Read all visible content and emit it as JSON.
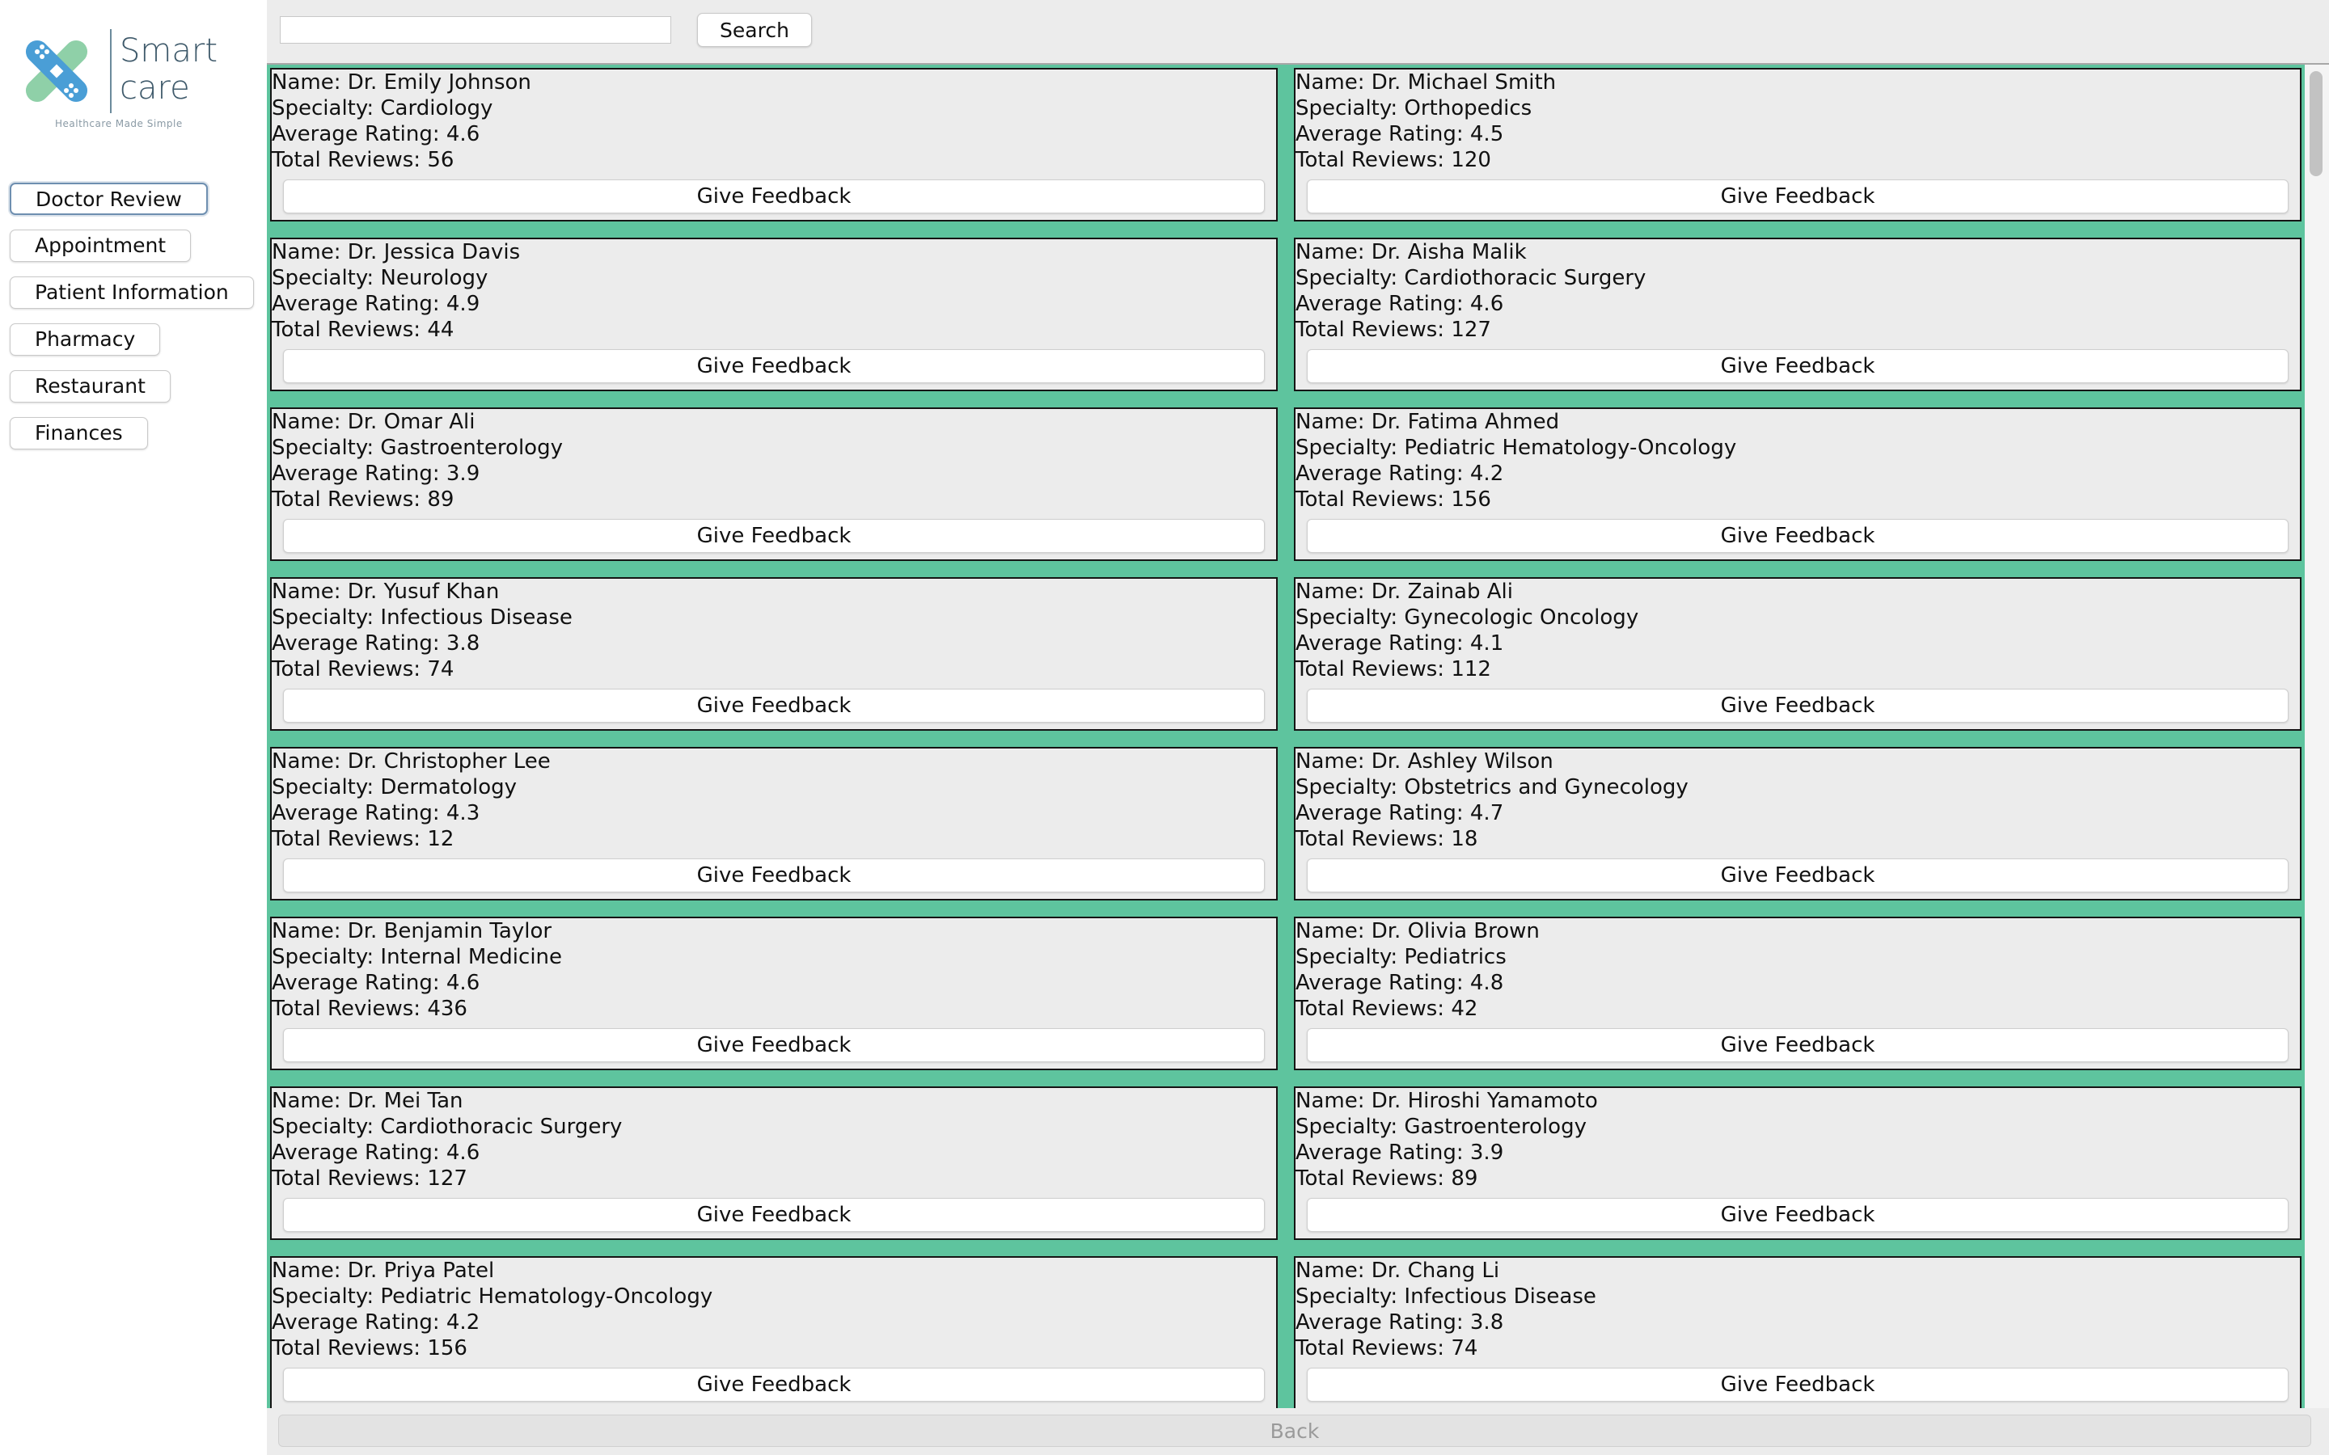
{
  "app": {
    "logo_line1": "Smart",
    "logo_line2": "care",
    "tagline": "Healthcare Made Simple",
    "accent_color": "#5ec49e"
  },
  "sidebar": {
    "items": [
      {
        "label": "Doctor Review",
        "active": true
      },
      {
        "label": "Appointment"
      },
      {
        "label": "Patient Information"
      },
      {
        "label": "Pharmacy"
      },
      {
        "label": "Restaurant"
      },
      {
        "label": "Finances"
      }
    ]
  },
  "search": {
    "value": "",
    "button_label": "Search"
  },
  "labels": {
    "name": "Name: ",
    "specialty": "Specialty: ",
    "rating": "Average Rating: ",
    "reviews": "Total Reviews: ",
    "feedback_button": "Give Feedback"
  },
  "doctors": [
    {
      "name": "Dr. Emily Johnson",
      "specialty": "Cardiology",
      "rating": "4.6",
      "reviews": "56"
    },
    {
      "name": "Dr. Michael Smith",
      "specialty": "Orthopedics",
      "rating": "4.5",
      "reviews": "120"
    },
    {
      "name": "Dr. Jessica Davis",
      "specialty": "Neurology",
      "rating": "4.9",
      "reviews": "44"
    },
    {
      "name": "Dr. Aisha Malik",
      "specialty": "Cardiothoracic Surgery",
      "rating": "4.6",
      "reviews": "127"
    },
    {
      "name": "Dr. Omar Ali",
      "specialty": "Gastroenterology",
      "rating": "3.9",
      "reviews": "89"
    },
    {
      "name": "Dr. Fatima Ahmed",
      "specialty": "Pediatric Hematology-Oncology",
      "rating": "4.2",
      "reviews": "156"
    },
    {
      "name": "Dr. Yusuf Khan",
      "specialty": "Infectious Disease",
      "rating": "3.8",
      "reviews": "74"
    },
    {
      "name": "Dr. Zainab Ali",
      "specialty": "Gynecologic Oncology",
      "rating": "4.1",
      "reviews": "112"
    },
    {
      "name": "Dr. Christopher Lee",
      "specialty": "Dermatology",
      "rating": "4.3",
      "reviews": "12"
    },
    {
      "name": "Dr. Ashley Wilson",
      "specialty": "Obstetrics and Gynecology",
      "rating": "4.7",
      "reviews": "18"
    },
    {
      "name": "Dr. Benjamin Taylor",
      "specialty": "Internal Medicine",
      "rating": "4.6",
      "reviews": "436"
    },
    {
      "name": "Dr. Olivia Brown",
      "specialty": "Pediatrics",
      "rating": "4.8",
      "reviews": "42"
    },
    {
      "name": "Dr. Mei Tan",
      "specialty": "Cardiothoracic Surgery",
      "rating": "4.6",
      "reviews": "127"
    },
    {
      "name": "Dr. Hiroshi Yamamoto",
      "specialty": "Gastroenterology",
      "rating": "3.9",
      "reviews": "89"
    },
    {
      "name": "Dr. Priya Patel",
      "specialty": "Pediatric Hematology-Oncology",
      "rating": "4.2",
      "reviews": "156"
    },
    {
      "name": "Dr. Chang Li",
      "specialty": "Infectious Disease",
      "rating": "3.8",
      "reviews": "74"
    }
  ],
  "footer": {
    "back_label": "Back"
  }
}
